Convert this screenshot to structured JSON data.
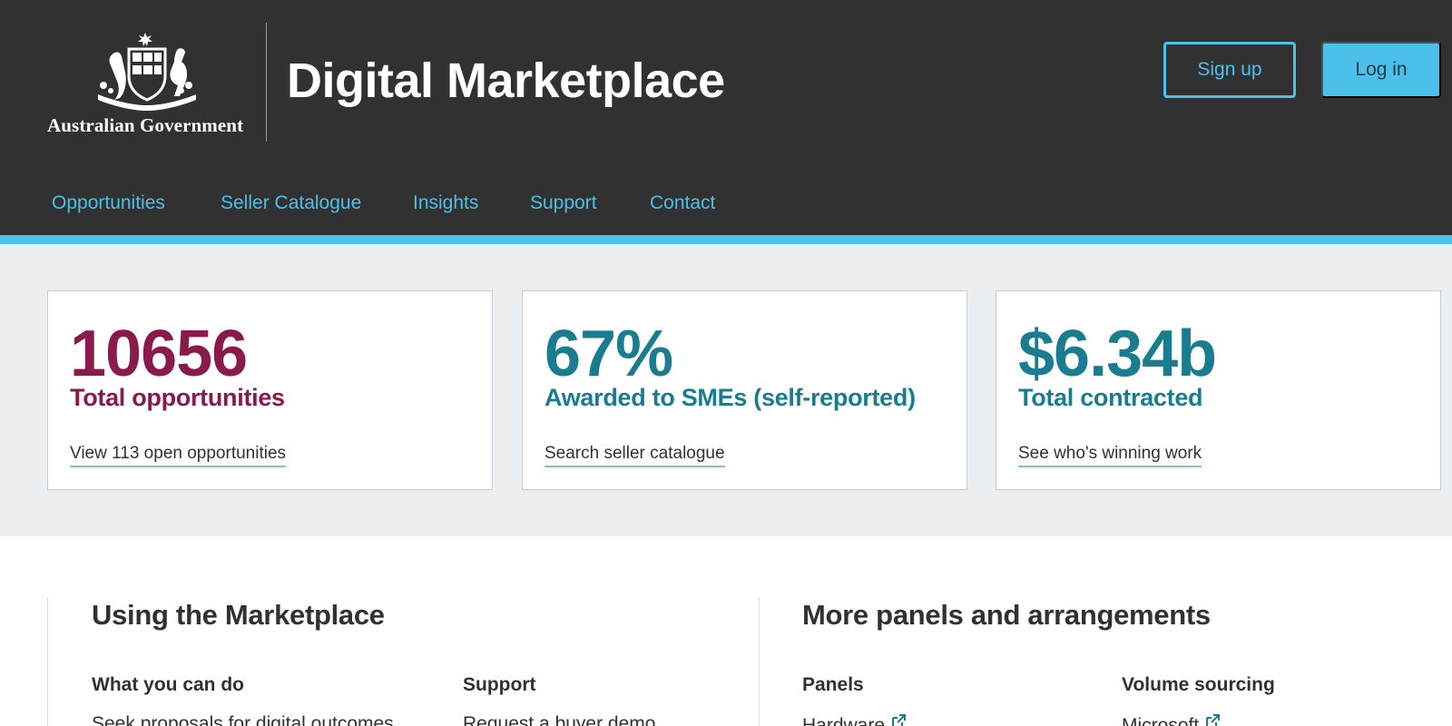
{
  "header": {
    "government_name": "Australian Government",
    "site_title": "Digital Marketplace",
    "signup_label": "Sign up",
    "login_label": "Log in"
  },
  "nav": {
    "items": [
      "Opportunities",
      "Seller Catalogue",
      "Insights",
      "Support",
      "Contact"
    ]
  },
  "stats": [
    {
      "number": "10656",
      "label": "Total opportunities",
      "link": "View 113 open opportunities",
      "color": "#8a1a4b"
    },
    {
      "number": "67%",
      "label": "Awarded to SMEs (self-reported)",
      "link": "Search seller catalogue",
      "color": "#1a7c8f"
    },
    {
      "number": "$6.34b",
      "label": "Total contracted",
      "link": "See who's winning work",
      "color": "#1a7c8f"
    }
  ],
  "using": {
    "title": "Using the Marketplace",
    "what_you_can_do": {
      "heading": "What you can do",
      "items": [
        "Seek proposals for digital outcomes"
      ]
    },
    "support": {
      "heading": "Support",
      "items": [
        "Request a buyer demo"
      ]
    }
  },
  "panels": {
    "title": "More panels and arrangements",
    "panels_col": {
      "heading": "Panels",
      "items": [
        "Hardware"
      ]
    },
    "volume_col": {
      "heading": "Volume sourcing",
      "items": [
        "Microsoft"
      ]
    }
  },
  "colors": {
    "header_bg": "#313131",
    "accent": "#4bc0ea",
    "maroon": "#8a1a4b",
    "teal": "#1a7c8f",
    "band_bg": "#ebeff2"
  },
  "icons": {
    "crest": "australian-coat-of-arms-icon",
    "external_link": "external-link-icon"
  }
}
